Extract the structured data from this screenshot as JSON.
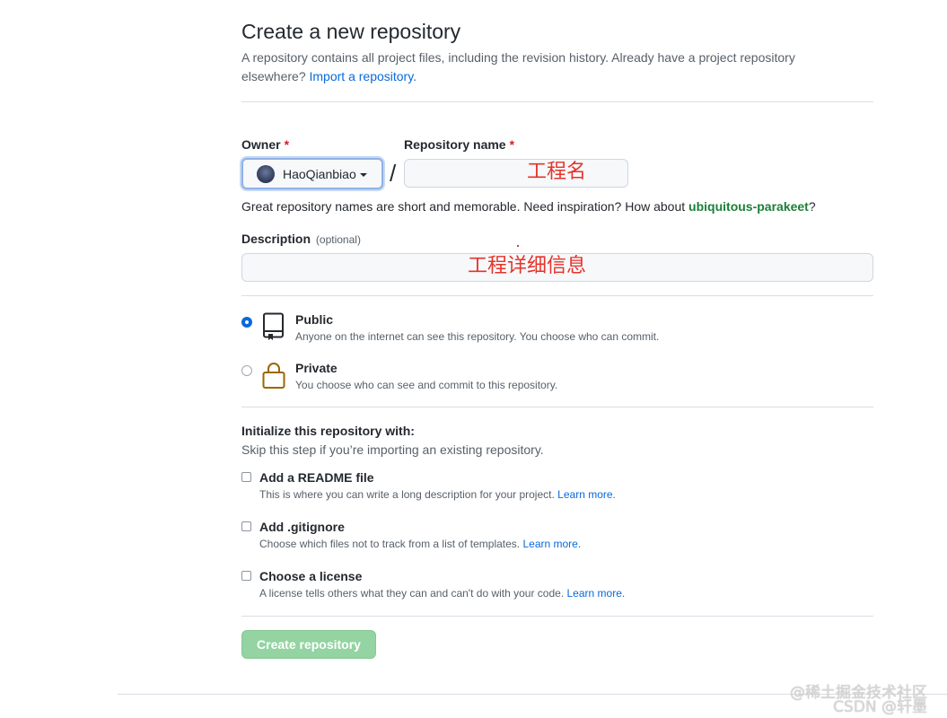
{
  "header": {
    "title": "Create a new repository",
    "subtitle": "A repository contains all project files, including the revision history. Already have a project repository elsewhere?",
    "import_link": "Import a repository."
  },
  "owner": {
    "label": "Owner",
    "required_mark": "*",
    "selected": "HaoQianbiao"
  },
  "separator": "/",
  "repo_name": {
    "label": "Repository name",
    "required_mark": "*",
    "value": "",
    "annotation": "工程名"
  },
  "name_hint": {
    "text": "Great repository names are short and memorable. Need inspiration? How about",
    "suggestion": "ubiquitous-parakeet",
    "end": "?"
  },
  "description": {
    "label": "Description",
    "optional": "(optional)",
    "value": "",
    "annotation": "工程详细信息"
  },
  "visibility": {
    "public": {
      "title": "Public",
      "desc": "Anyone on the internet can see this repository. You choose who can commit.",
      "checked": true
    },
    "private": {
      "title": "Private",
      "desc": "You choose who can see and commit to this repository.",
      "checked": false
    }
  },
  "init": {
    "title": "Initialize this repository with:",
    "subtitle": "Skip this step if you’re importing an existing repository.",
    "options": [
      {
        "title": "Add a README file",
        "desc": "This is where you can write a long description for your project.",
        "link": "Learn more."
      },
      {
        "title": "Add .gitignore",
        "desc": "Choose which files not to track from a list of templates.",
        "link": "Learn more."
      },
      {
        "title": "Choose a license",
        "desc": "A license tells others what they can and can't do with your code.",
        "link": "Learn more."
      }
    ]
  },
  "submit_label": "Create repository",
  "watermark": {
    "line1": "@稀土掘金技术社区",
    "line2": "CSDN @轩墨"
  },
  "colors": {
    "link": "#0969da",
    "suggestion": "#1a7f37",
    "required": "#cf222e",
    "annotation": "#e5332a",
    "create_button": "#94d3a2"
  }
}
